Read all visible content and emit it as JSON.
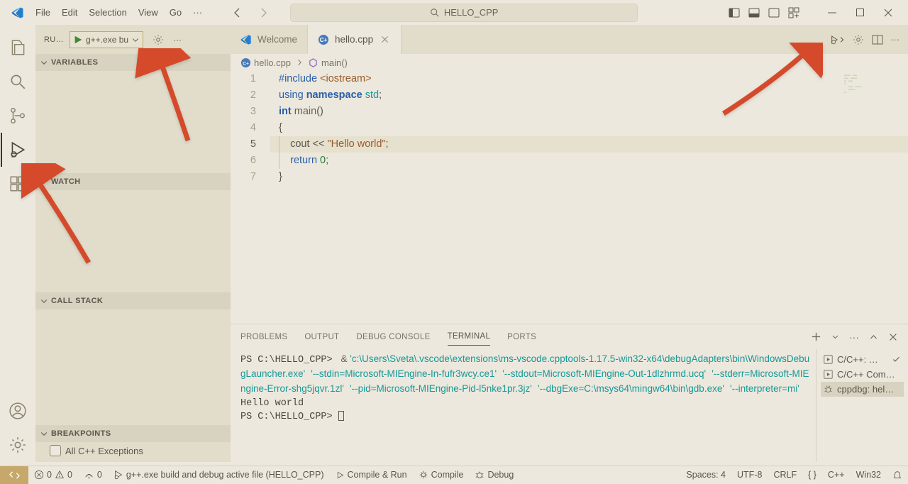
{
  "titlebar": {
    "menu": [
      "File",
      "Edit",
      "Selection",
      "View",
      "Go"
    ],
    "search_placeholder": "HELLO_CPP"
  },
  "activitybar": {
    "items": [
      "explorer",
      "search",
      "scm",
      "debug",
      "extensions"
    ]
  },
  "sidebar": {
    "run_label": "RU…",
    "config_name": "g++.exe bu",
    "sections": {
      "variables": "VARIABLES",
      "watch": "WATCH",
      "callstack": "CALL STACK",
      "breakpoints": "BREAKPOINTS"
    },
    "watch_items": [
      ":"
    ],
    "breakpoints_items": [
      "All C++ Exceptions"
    ]
  },
  "tabs": [
    {
      "label": "Welcome",
      "active": false,
      "icon": "vscode"
    },
    {
      "label": "hello.cpp",
      "active": true,
      "icon": "cpp"
    }
  ],
  "breadcrumb": [
    {
      "icon": "cpp",
      "label": "hello.cpp"
    },
    {
      "icon": "method",
      "label": "main()"
    }
  ],
  "code": {
    "lines": [
      {
        "n": 1,
        "tokens": [
          {
            "t": "#include ",
            "c": "kw"
          },
          {
            "t": "<iostream>",
            "c": "lib"
          }
        ]
      },
      {
        "n": 2,
        "tokens": [
          {
            "t": "using ",
            "c": "kw"
          },
          {
            "t": "namespace ",
            "c": "kw",
            "bold": true
          },
          {
            "t": "std",
            "c": "ns"
          },
          {
            "t": ";",
            "c": "punc"
          }
        ]
      },
      {
        "n": 3,
        "tokens": [
          {
            "t": "int ",
            "c": "kw",
            "bold": true
          },
          {
            "t": "main",
            "c": "fn"
          },
          {
            "t": "()",
            "c": "punc"
          }
        ]
      },
      {
        "n": 4,
        "tokens": [
          {
            "t": "{",
            "c": "punc"
          }
        ]
      },
      {
        "n": 5,
        "indent": 1,
        "active": true,
        "tokens": [
          {
            "t": "    cout ",
            "c": "op"
          },
          {
            "t": "<< ",
            "c": "op"
          },
          {
            "t": "\"Hello world\"",
            "c": "str"
          },
          {
            "t": ";",
            "c": "punc"
          }
        ]
      },
      {
        "n": 6,
        "indent": 1,
        "tokens": [
          {
            "t": "    ",
            "c": "op"
          },
          {
            "t": "return ",
            "c": "kw"
          },
          {
            "t": "0",
            "c": "num"
          },
          {
            "t": ";",
            "c": "punc"
          }
        ]
      },
      {
        "n": 7,
        "tokens": [
          {
            "t": "}",
            "c": "punc"
          }
        ]
      }
    ]
  },
  "panel": {
    "tabs": [
      "PROBLEMS",
      "OUTPUT",
      "DEBUG CONSOLE",
      "TERMINAL",
      "PORTS"
    ],
    "active_tab": "TERMINAL",
    "terminal": {
      "prompt1": "PS C:\\HELLO_CPP> ",
      "command_prefix": " & ",
      "str1": "'c:\\Users\\Sveta\\.vscode\\extensions\\ms-vscode.cpptools-1.17.5-win32-x64\\debugAdapters\\bin\\WindowsDebugLauncher.exe'",
      "str2": "'--stdin=Microsoft-MIEngine-In-fufr3wcy.ce1'",
      "str3": "'--stdout=Microsoft-MIEngine-Out-1dlzhrmd.ucq'",
      "str4": "'--stderr=Microsoft-MIEngine-Error-shg5jqvr.1zl'",
      "str5": "'--pid=Microsoft-MIEngine-Pid-l5nke1pr.3jz'",
      "str6": "'--dbgExe=C:\\msys64\\mingw64\\bin\\gdb.exe'",
      "str7": "'--interpreter=mi'",
      "output1": "Hello world",
      "prompt2": "PS C:\\HELLO_CPP> "
    },
    "terminal_list": [
      {
        "label": "C/C++: …",
        "icon": "play",
        "tail": "check"
      },
      {
        "label": "C/C++ Com…",
        "icon": "play"
      },
      {
        "label": "cppdbg: hel…",
        "icon": "bug",
        "active": true
      }
    ]
  },
  "statusbar": {
    "errors": "0",
    "warnings": "0",
    "ports": "0",
    "debug_target": "g++.exe build and debug active file (HELLO_CPP)",
    "compile_run": "Compile & Run",
    "compile": "Compile",
    "debug": "Debug",
    "spaces": "Spaces: 4",
    "encoding": "UTF-8",
    "eol": "CRLF",
    "lang": "C++",
    "platform": "Win32"
  }
}
